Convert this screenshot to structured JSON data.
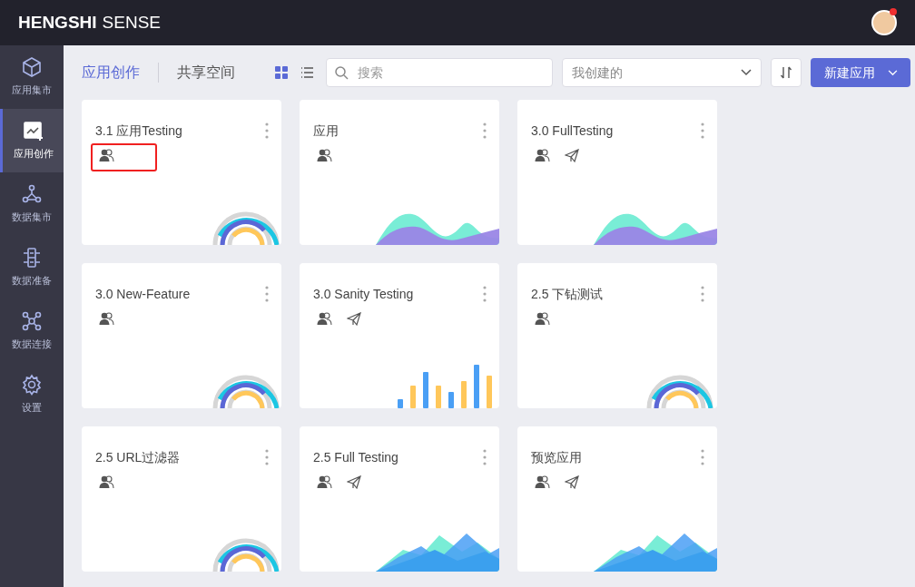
{
  "header": {
    "logo_bold": "HENGSHI",
    "logo_light": "SENSE"
  },
  "sidebar": {
    "items": [
      {
        "label": "应用集市",
        "kind": "cube",
        "selected": false
      },
      {
        "label": "应用创作",
        "kind": "chart",
        "selected": true
      },
      {
        "label": "数据集市",
        "kind": "hub",
        "selected": false
      },
      {
        "label": "数据准备",
        "kind": "prep",
        "selected": false
      },
      {
        "label": "数据连接",
        "kind": "connect",
        "selected": false
      },
      {
        "label": "设置",
        "kind": "gear",
        "selected": false
      }
    ]
  },
  "tabs": [
    {
      "label": "应用创作",
      "selected": true
    },
    {
      "label": "共享空间",
      "selected": false
    }
  ],
  "view_mode": {
    "grid_selected": true
  },
  "search": {
    "placeholder": "搜索"
  },
  "filter": {
    "value": "我创建的"
  },
  "new_button": {
    "label": "新建应用"
  },
  "cards": [
    {
      "title": "3.1 应用Testing",
      "shared": false,
      "highlighted": true,
      "kind": "rings"
    },
    {
      "title": "应用",
      "shared": false,
      "highlighted": false,
      "kind": "waves"
    },
    {
      "title": "3.0 FullTesting",
      "shared": true,
      "highlighted": false,
      "kind": "waves"
    },
    {
      "title": "3.0 New-Feature",
      "shared": false,
      "highlighted": false,
      "kind": "rings"
    },
    {
      "title": "3.0 Sanity Testing",
      "shared": true,
      "highlighted": false,
      "kind": "bars"
    },
    {
      "title": "2.5 下钻测试",
      "shared": false,
      "highlighted": false,
      "kind": "rings_center"
    },
    {
      "title": "2.5 URL过滤器",
      "shared": false,
      "highlighted": false,
      "kind": "rings"
    },
    {
      "title": "2.5 Full Testing",
      "shared": true,
      "highlighted": false,
      "kind": "mountains"
    },
    {
      "title": "预览应用",
      "shared": true,
      "highlighted": false,
      "kind": "mountains"
    }
  ]
}
